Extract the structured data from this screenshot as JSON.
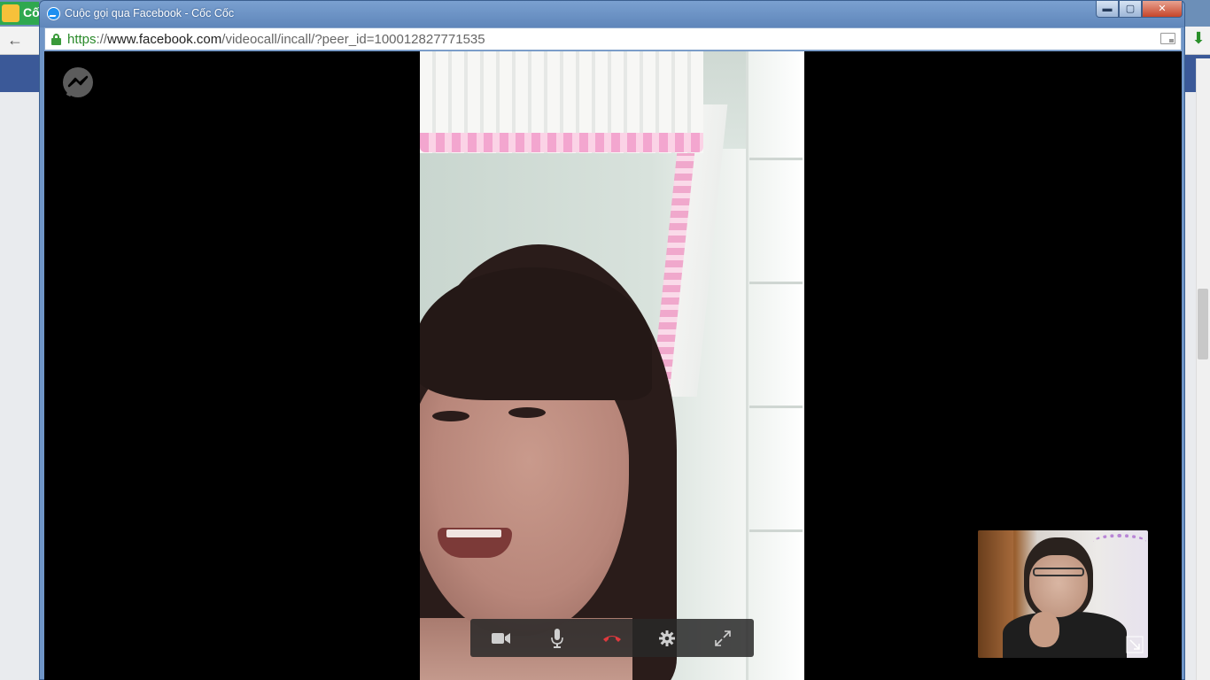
{
  "window": {
    "title": "Cuộc gọi qua Facebook - Cốc Cốc",
    "buttons": {
      "minimize": "▬",
      "maximize": "▢",
      "close": "✕"
    }
  },
  "addressbar": {
    "url_scheme": "https",
    "url_sep": "://",
    "url_domain": "www.facebook.com",
    "url_path": "/videocall/incall/?peer_id=100012827771535"
  },
  "background_browser": {
    "logo_text": "Cố"
  },
  "call": {
    "controls": [
      {
        "name": "camera",
        "icon": "video-camera-icon"
      },
      {
        "name": "microphone",
        "icon": "microphone-icon"
      },
      {
        "name": "end-call",
        "icon": "phone-hangup-icon"
      },
      {
        "name": "settings",
        "icon": "gear-icon"
      },
      {
        "name": "fullscreen",
        "icon": "expand-icon"
      }
    ]
  },
  "colors": {
    "accent": "#3b5998",
    "hangup": "#e0393e",
    "titlebar": "#6f95c7"
  }
}
